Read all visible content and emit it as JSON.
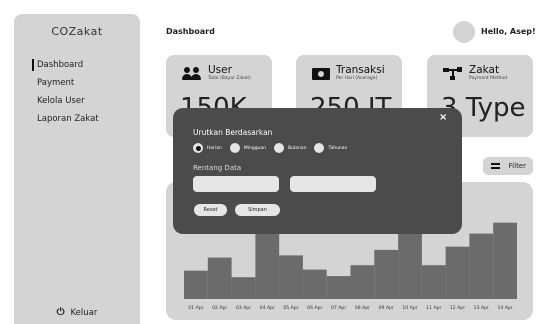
{
  "sidebar": {
    "brand": "COZakat",
    "items": [
      {
        "label": "Dashboard",
        "active": true
      },
      {
        "label": "Payment",
        "active": false
      },
      {
        "label": "Kelola User",
        "active": false
      },
      {
        "label": "Laporan Zakat",
        "active": false
      }
    ],
    "logout_label": "Keluar",
    "logout_icon": "power-icon"
  },
  "header": {
    "title": "Dashboard",
    "greeting": "Hello, Asep!"
  },
  "cards": [
    {
      "title": "User",
      "subtitle": "Total (Bayar Zakat)",
      "value": "150K",
      "icon": "users-icon"
    },
    {
      "title": "Transaksi",
      "subtitle": "Per Hari (Average)",
      "value": "250 JT",
      "icon": "money-icon"
    },
    {
      "title": "Zakat",
      "subtitle": "Payment Method",
      "value": "3 Type",
      "icon": "method-icon"
    }
  ],
  "filter": {
    "label": "Filter",
    "icon": "filter-icon"
  },
  "chart_data": {
    "type": "bar",
    "categories": [
      "01 Apr",
      "02 Apr",
      "03 Apr",
      "04 Apr",
      "05 Apr",
      "06 Apr",
      "07 Apr",
      "08 Apr",
      "09 Apr",
      "10 Apr",
      "11 Apr",
      "12 Apr",
      "13 Apr",
      "14 Apr"
    ],
    "values": [
      26,
      38,
      20,
      100,
      40,
      27,
      21,
      31,
      45,
      100,
      31,
      48,
      60,
      70
    ],
    "ylim": [
      0,
      100
    ],
    "colors": {
      "bar": "#6b6b6b",
      "background": "#d4d4d4"
    },
    "grid": false
  },
  "modal": {
    "title": "Urutkan Berdasarkan",
    "options": [
      {
        "label": "Harian",
        "selected": true
      },
      {
        "label": "Mingguan",
        "selected": false
      },
      {
        "label": "Bulanan",
        "selected": false
      },
      {
        "label": "Tahunan",
        "selected": false
      }
    ],
    "range_label": "Rentang Data",
    "start_value": "",
    "end_value": "",
    "reset_label": "Reset",
    "save_label": "Simpan",
    "close_label": "×"
  }
}
